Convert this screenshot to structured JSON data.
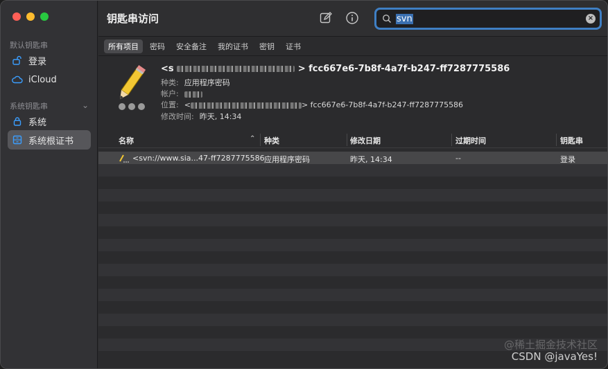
{
  "sidebar": {
    "section_default": "默认钥匙串",
    "section_system": "系统钥匙串",
    "items": [
      {
        "label": "登录",
        "icon": "lock-open-icon"
      },
      {
        "label": "iCloud",
        "icon": "cloud-icon"
      },
      {
        "label": "系统",
        "icon": "lock-icon"
      },
      {
        "label": "系统根证书",
        "icon": "cabinet-icon",
        "selected": true
      }
    ]
  },
  "header": {
    "title": "钥匙串访问",
    "search_value": "svn"
  },
  "tabs": [
    {
      "label": "所有项目",
      "active": true
    },
    {
      "label": "密码"
    },
    {
      "label": "安全备注"
    },
    {
      "label": "我的证书"
    },
    {
      "label": "密钥"
    },
    {
      "label": "证书"
    }
  ],
  "detail": {
    "name_prefix": "<s",
    "name_suffix": "> fcc667e6-7b8f-4a7f-b247-ff7287775586",
    "kind_label": "种类:",
    "kind_value": "应用程序密码",
    "account_label": "帐户:",
    "location_label": "位置:",
    "location_prefix": "<",
    "location_suffix": "> fcc667e6-7b8f-4a7f-b247-ff7287775586",
    "modified_label": "修改时间:",
    "modified_value": "昨天, 14:34"
  },
  "table": {
    "columns": [
      "名称",
      "种类",
      "修改日期",
      "过期时间",
      "钥匙串"
    ],
    "rows": [
      {
        "name": "<svn://www.sia...47-ff7287775586",
        "kind": "应用程序密码",
        "modified": "昨天, 14:34",
        "expires": "--",
        "keychain": "登录"
      }
    ]
  },
  "watermark": {
    "line1": "@稀土掘金技术社区",
    "line2": "CSDN @javaYes!"
  },
  "colors": {
    "accent": "#3f7fc4",
    "sidebar_icon": "#3b9eff"
  }
}
